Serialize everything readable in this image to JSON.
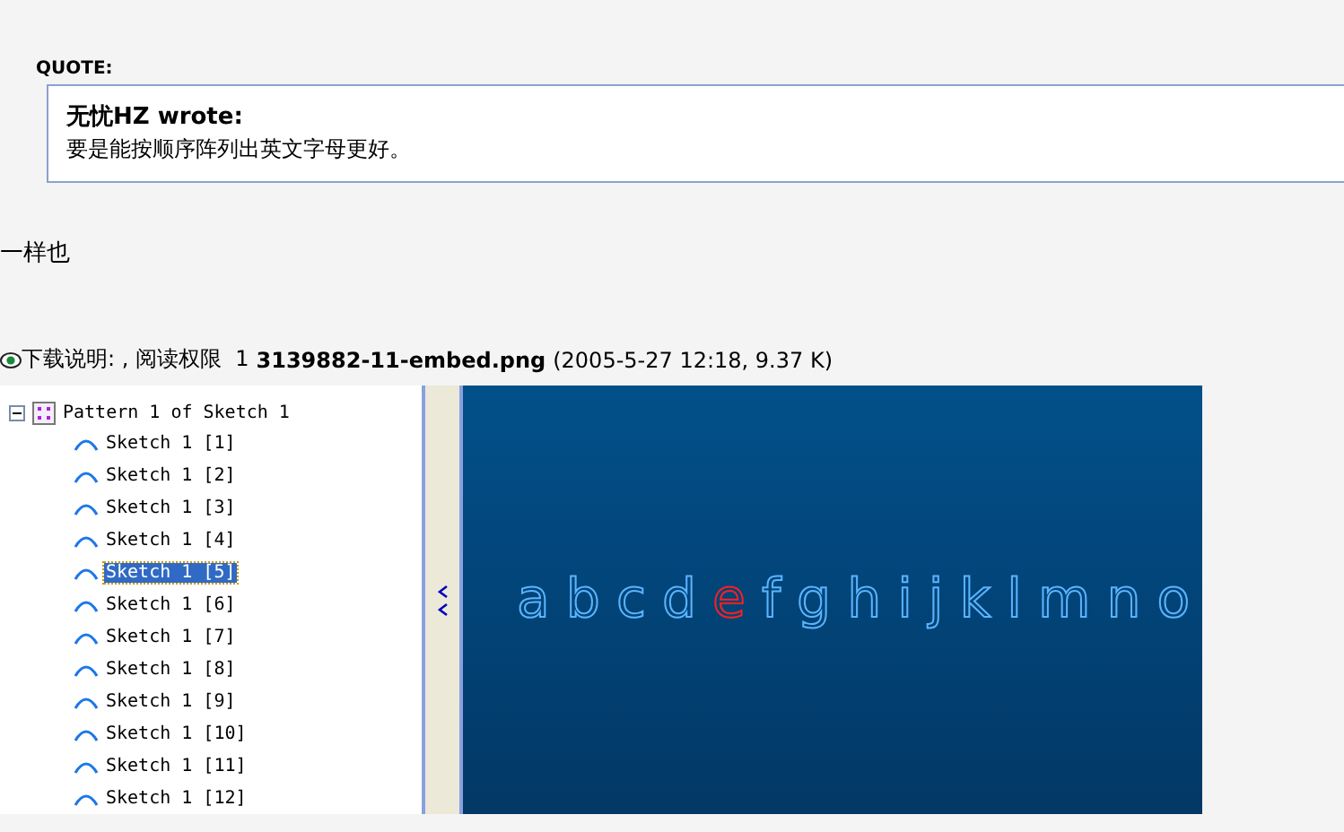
{
  "quote": {
    "label": "QUOTE:",
    "author": "无忧HZ wrote:",
    "text": "要是能按顺序阵列出英文字母更好。"
  },
  "post_text": "一样也",
  "attachment": {
    "description": "下载说明: , 阅读权限  1",
    "filename": "3139882-11-embed.png",
    "meta": "(2005-5-27 12:18, 9.37 K)"
  },
  "screenshot": {
    "tree": {
      "label": "Pattern 1 of Sketch 1",
      "expanded": true,
      "children": [
        {
          "label": "Sketch 1 [1]",
          "selected": false
        },
        {
          "label": "Sketch 1 [2]",
          "selected": false
        },
        {
          "label": "Sketch 1 [3]",
          "selected": false
        },
        {
          "label": "Sketch 1 [4]",
          "selected": false
        },
        {
          "label": "Sketch 1 [5]",
          "selected": true
        },
        {
          "label": "Sketch 1 [6]",
          "selected": false
        },
        {
          "label": "Sketch 1 [7]",
          "selected": false
        },
        {
          "label": "Sketch 1 [8]",
          "selected": false
        },
        {
          "label": "Sketch 1 [9]",
          "selected": false
        },
        {
          "label": "Sketch 1 [10]",
          "selected": false
        },
        {
          "label": "Sketch 1 [11]",
          "selected": false
        },
        {
          "label": "Sketch 1 [12]",
          "selected": false
        }
      ]
    },
    "letters": [
      {
        "char": "a",
        "highlighted": false
      },
      {
        "char": "b",
        "highlighted": false
      },
      {
        "char": "c",
        "highlighted": false
      },
      {
        "char": "d",
        "highlighted": false
      },
      {
        "char": "e",
        "highlighted": true
      },
      {
        "char": "f",
        "highlighted": false
      },
      {
        "char": "g",
        "highlighted": false
      },
      {
        "char": "h",
        "highlighted": false
      },
      {
        "char": "i",
        "highlighted": false
      },
      {
        "char": "j",
        "highlighted": false
      },
      {
        "char": "k",
        "highlighted": false
      },
      {
        "char": "l",
        "highlighted": false
      },
      {
        "char": "m",
        "highlighted": false
      },
      {
        "char": "n",
        "highlighted": false
      },
      {
        "char": "o",
        "highlighted": false
      }
    ]
  }
}
